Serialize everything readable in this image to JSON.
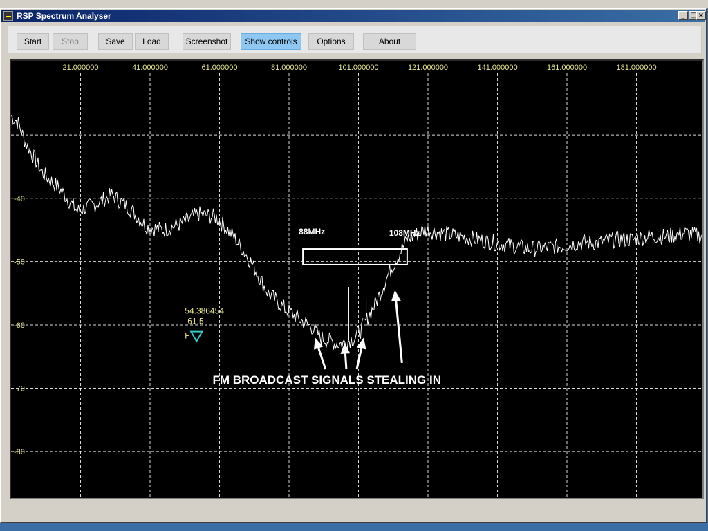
{
  "window": {
    "title": "RSP Spectrum Analyser",
    "minimize": "_",
    "maximize": "□",
    "close": "×"
  },
  "toolbar": {
    "start": "Start",
    "stop": "Stop",
    "save": "Save",
    "load": "Load",
    "screenshot": "Screenshot",
    "show_controls": "Show controls",
    "options": "Options",
    "about": "About"
  },
  "chart_data": {
    "type": "line",
    "x_unit_ticks": [
      "21.000000",
      "41.000000",
      "61.000000",
      "81.000000",
      "101.000000",
      "121.000000",
      "141.000000",
      "161.000000",
      "181.000000"
    ],
    "x_ticks": [
      21,
      41,
      61,
      81,
      101,
      121,
      141,
      161,
      181
    ],
    "xlim": [
      1,
      200
    ],
    "y_ticks": [
      -40,
      -50,
      -60,
      -70,
      -80
    ],
    "y_tick_labels": [
      "-40",
      "-50",
      "-60",
      "-70",
      "-80"
    ],
    "ylim": [
      -87.3,
      -18.3
    ],
    "grid": true,
    "series": [
      {
        "x": [
          1,
          3,
          5,
          8,
          10,
          15,
          20,
          25,
          30,
          35,
          40,
          45,
          50,
          55,
          60,
          65,
          70,
          75,
          80,
          85,
          88,
          90,
          93,
          95,
          97,
          100,
          102,
          104,
          106,
          108,
          110,
          115,
          120,
          125,
          130,
          135,
          140,
          145,
          150,
          155,
          160,
          165,
          170,
          175,
          180,
          185,
          190,
          195,
          200
        ],
        "y": [
          -27,
          -28,
          -31,
          -34,
          -36,
          -38.5,
          -42,
          -41,
          -39.5,
          -41.5,
          -44.5,
          -45,
          -44,
          -42.5,
          -43,
          -46,
          -50,
          -55,
          -57.5,
          -59.5,
          -60.5,
          -62,
          -62.5,
          -63,
          -62.8,
          -62,
          -60.5,
          -58.5,
          -56.5,
          -54,
          -51.5,
          -46.5,
          -45,
          -45.5,
          -46,
          -46.5,
          -47,
          -47.5,
          -48,
          -47.8,
          -47.5,
          -47,
          -47,
          -46.5,
          -46.5,
          -46,
          -46,
          -45.5,
          -46
        ]
      }
    ],
    "spikes": [
      {
        "x": 98.2,
        "y": -54
      },
      {
        "x": 103.2,
        "y": -56
      }
    ],
    "marker": {
      "frequency": "54.386454",
      "level": "-61.5",
      "flag": "F",
      "x": 54.386454,
      "y": -61.5,
      "color": "#33cccc"
    },
    "annotations": {
      "label_88": "88MHz",
      "label_108": "108MHz",
      "caption": "FM BROADCAST SIGNALS STEALING IN",
      "band_box": {
        "x_start": 85,
        "x_end": 115,
        "y_top": -48,
        "y_bottom": -50.5
      },
      "arrows": [
        {
          "from": [
            91.5,
            -67
          ],
          "to": [
            88.5,
            -62
          ]
        },
        {
          "from": [
            97.5,
            -67
          ],
          "to": [
            97,
            -62.8
          ]
        },
        {
          "from": [
            100.5,
            -67
          ],
          "to": [
            102.5,
            -62
          ]
        },
        {
          "from": [
            113.5,
            -66
          ],
          "to": [
            111.5,
            -54.5
          ]
        }
      ]
    },
    "colors": {
      "trace": "#ffffff",
      "grid": "#ffffff",
      "x_label": "#e8e890",
      "y_label": "#e8e890",
      "marker": "#33cccc"
    }
  }
}
